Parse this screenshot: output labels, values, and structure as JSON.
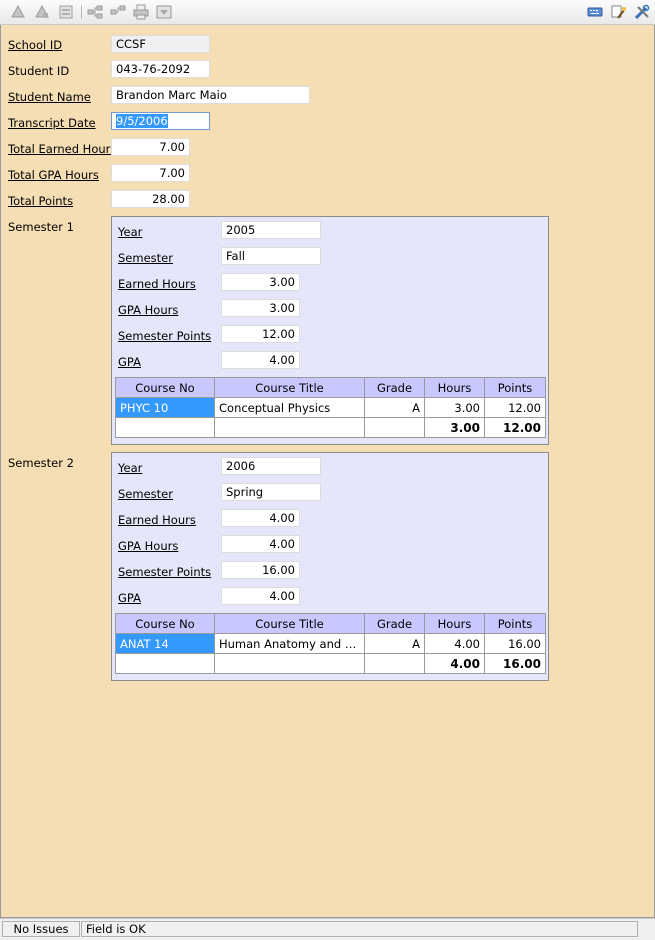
{
  "toolbar": {
    "left_icons": [
      "up-arrow-icon",
      "down-arrow-icon",
      "form-icon",
      "tree-add-icon",
      "tree-remove-icon",
      "print-icon",
      "filter-icon"
    ],
    "right_icons": [
      "keyboard-icon",
      "magic-wand-icon",
      "tools-icon"
    ]
  },
  "form": {
    "school_id": {
      "label": "School ID",
      "value": "CCSF"
    },
    "student_id": {
      "label": "Student ID",
      "value": "043-76-2092"
    },
    "student_name": {
      "label": "Student Name",
      "value": "Brandon Marc Maio"
    },
    "transcript_date": {
      "label": "Transcript Date",
      "value": "9/5/2006"
    },
    "total_earned_hours": {
      "label": "Total Earned Hours",
      "value": "7.00"
    },
    "total_gpa_hours": {
      "label": "Total GPA Hours",
      "value": "7.00"
    },
    "total_points": {
      "label": "Total Points",
      "value": "28.00"
    }
  },
  "semester_labels": {
    "year": "Year",
    "semester": "Semester",
    "earned_hours": "Earned Hours",
    "gpa_hours": "GPA Hours",
    "semester_points": "Semester Points",
    "gpa": "GPA"
  },
  "grid_headers": {
    "course_no": "Course No",
    "course_title": "Course Title",
    "grade": "Grade",
    "hours": "Hours",
    "points": "Points"
  },
  "semesters": [
    {
      "title": "Semester 1",
      "year": "2005",
      "semester": "Fall",
      "earned_hours": "3.00",
      "gpa_hours": "3.00",
      "semester_points": "12.00",
      "gpa": "4.00",
      "courses": [
        {
          "course_no": "PHYC 10",
          "course_title": "Conceptual Physics",
          "grade": "A",
          "hours": "3.00",
          "points": "12.00"
        }
      ],
      "total_hours": "3.00",
      "total_points": "12.00"
    },
    {
      "title": "Semester 2",
      "year": "2006",
      "semester": "Spring",
      "earned_hours": "4.00",
      "gpa_hours": "4.00",
      "semester_points": "16.00",
      "gpa": "4.00",
      "courses": [
        {
          "course_no": "ANAT 14",
          "course_title": "Human Anatomy and Physi...",
          "grade": "A",
          "hours": "4.00",
          "points": "16.00"
        }
      ],
      "total_hours": "4.00",
      "total_points": "16.00"
    }
  ],
  "status": {
    "issues": "No Issues",
    "field": "Field is OK"
  }
}
